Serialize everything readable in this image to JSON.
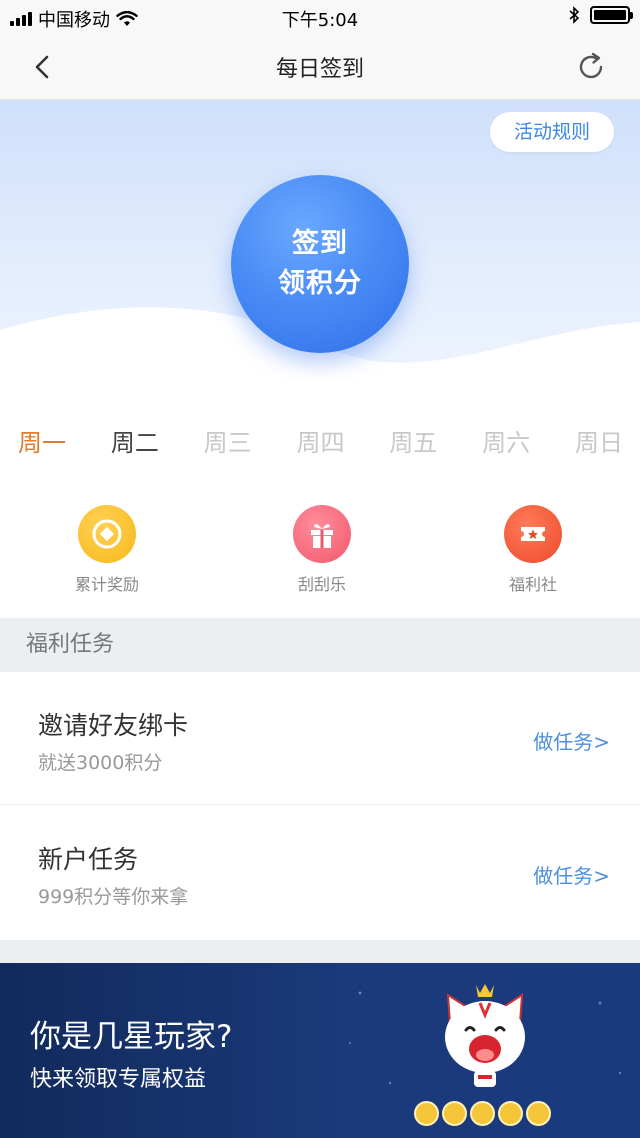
{
  "status_bar": {
    "carrier": "中国移动",
    "time": "下午5:04"
  },
  "nav": {
    "title": "每日签到",
    "back_icon": "chevron-left-icon",
    "refresh_icon": "refresh-icon"
  },
  "hero": {
    "rules_label": "活动规则",
    "checkin_line1": "签到",
    "checkin_line2": "领积分"
  },
  "weekdays": [
    {
      "label": "周一",
      "state": "signed"
    },
    {
      "label": "周二",
      "state": "today"
    },
    {
      "label": "周三",
      "state": "future"
    },
    {
      "label": "周四",
      "state": "future"
    },
    {
      "label": "周五",
      "state": "future"
    },
    {
      "label": "周六",
      "state": "future"
    },
    {
      "label": "周日",
      "state": "future"
    }
  ],
  "shortcuts": [
    {
      "label": "累计奖励",
      "icon": "coin-icon",
      "color": "#f7b81a"
    },
    {
      "label": "刮刮乐",
      "icon": "gift-icon",
      "color": "#f1576b"
    },
    {
      "label": "福利社",
      "icon": "ticket-icon",
      "color": "#ec4a2c"
    }
  ],
  "section": {
    "title": "福利任务"
  },
  "tasks": [
    {
      "title": "邀请好友绑卡",
      "subtitle": "就送3000积分",
      "action": "做任务>"
    },
    {
      "title": "新户任务",
      "subtitle": "999积分等你来拿",
      "action": "做任务>"
    }
  ],
  "banner": {
    "title": "你是几星玩家?",
    "subtitle": "快来领取专属权益",
    "stars": 5
  },
  "colors": {
    "accent": "#3d86e6",
    "signed_day": "#e07b30",
    "banner_bg": "#1b3a7a"
  }
}
